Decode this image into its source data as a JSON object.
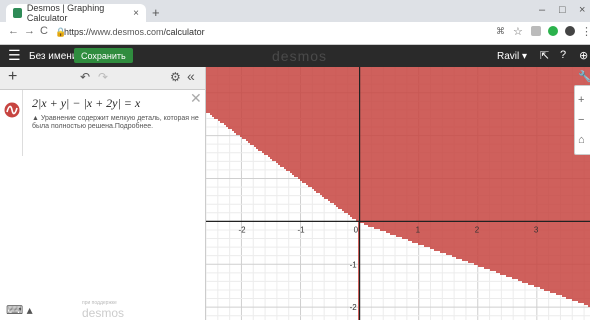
{
  "browser": {
    "tab_title": "Desmos | Graphing Calculator",
    "tab_close": "×",
    "new_tab": "+",
    "url_scheme": "https://",
    "url_host": "www.desmos.com",
    "url_path": "/calculator",
    "minimize": "–",
    "maximize": "□",
    "close": "×"
  },
  "header": {
    "graph_name": "Без имени",
    "save_label": "Сохранить",
    "logo": "desmos",
    "user": "Ravil ▾"
  },
  "expression": {
    "latex": "2|x + y| − |x + 2y| = x",
    "warning": "▲ Уравнение содержит мелкую деталь, которая не была полностью решена.Подробнее."
  },
  "footer": {
    "powered": "при поддержке",
    "brand": "desmos"
  },
  "graph": {
    "x_ticks": [
      "-2",
      "-1",
      "0",
      "1",
      "2",
      "3"
    ],
    "y_ticks": [
      "-1",
      "-2"
    ],
    "curve_color": "#c74440",
    "axis_color": "#222222",
    "x_range": [
      -2.6,
      3.9
    ],
    "y_range": [
      -2.3,
      3.6
    ]
  },
  "colors": {
    "header_bg": "#2a2a2a",
    "save_bg": "#2f8c3e"
  },
  "icons": {
    "menu": "hamburger-icon",
    "add": "plus-icon",
    "undo": "undo-icon",
    "redo": "redo-icon",
    "settings": "gear-icon",
    "collapse": "collapse-icon",
    "keyboard": "keyboard-icon"
  }
}
